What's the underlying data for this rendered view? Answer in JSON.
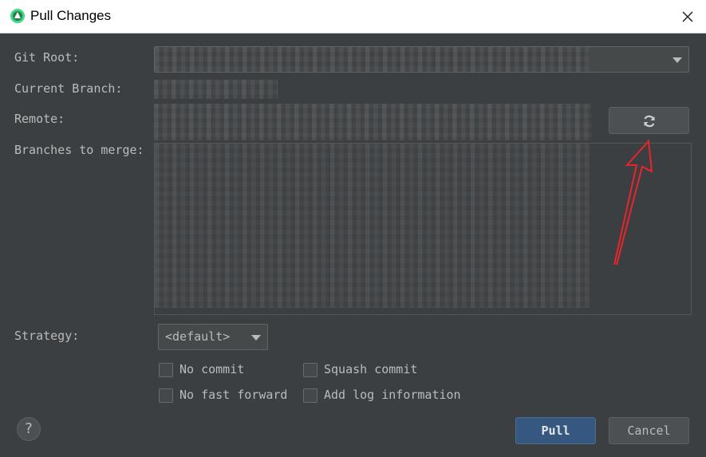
{
  "window": {
    "title": "Pull Changes",
    "app_icon": "android-studio-icon",
    "close_icon": "close-icon"
  },
  "form": {
    "git_root_label": "Git Root:",
    "current_branch_label": "Current Branch:",
    "remote_label": "Remote:",
    "branches_label": "Branches to merge:",
    "strategy_label": "Strategy:",
    "strategy_value": "<default>",
    "refresh_icon": "refresh-icon"
  },
  "options": {
    "no_commit": "No commit",
    "squash_commit": "Squash commit",
    "no_fast_forward": "No fast forward",
    "add_log_information": "Add log information"
  },
  "buttons": {
    "help": "?",
    "pull": "Pull",
    "cancel": "Cancel"
  },
  "annotation": {
    "arrow_color": "#e8252b"
  }
}
